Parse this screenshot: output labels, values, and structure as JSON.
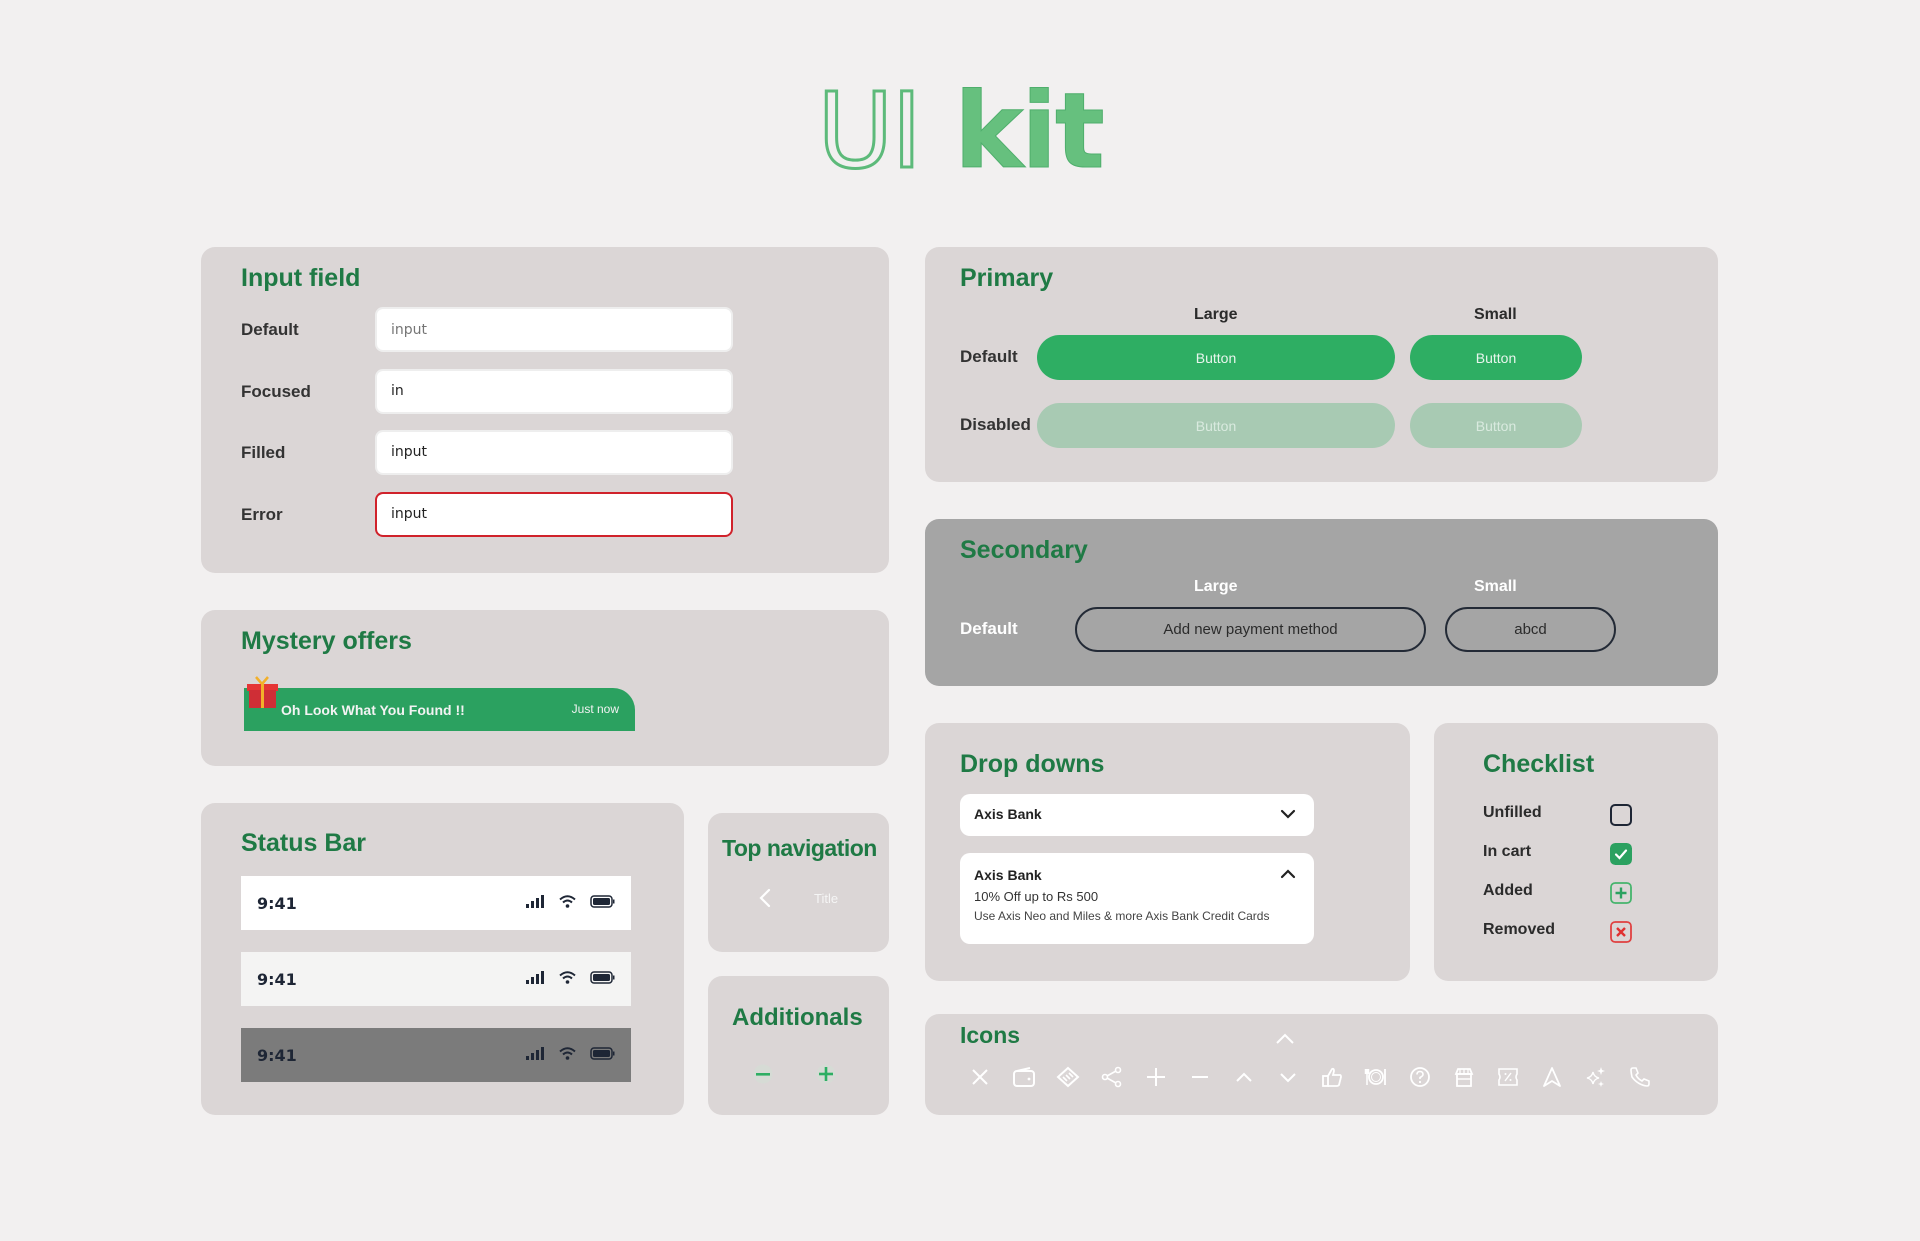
{
  "header": {
    "title_outline": "UI",
    "title_solid": "kit"
  },
  "colors": {
    "brand_green": "#2eae63",
    "title_green": "#1f7a45",
    "error_red": "#d0222b",
    "panel_bg": "#dbd6d6",
    "page_bg": "#f2f0f0"
  },
  "input_field": {
    "title": "Input field",
    "rows": [
      {
        "label": "Default",
        "value": "",
        "placeholder": "input",
        "state": "default"
      },
      {
        "label": "Focused",
        "value": "in",
        "placeholder": "",
        "state": "focused"
      },
      {
        "label": "Filled",
        "value": "input",
        "placeholder": "",
        "state": "filled"
      },
      {
        "label": "Error",
        "value": "input",
        "placeholder": "",
        "state": "error"
      }
    ]
  },
  "mystery_offers": {
    "title": "Mystery offers",
    "message": "Oh Look What You Found !!",
    "time": "Just now",
    "icon": "gift-icon"
  },
  "status_bar": {
    "title": "Status Bar",
    "bars": [
      {
        "time": "9:41",
        "variant": "white",
        "bg": "#ffffff"
      },
      {
        "time": "9:41",
        "variant": "light",
        "bg": "#f4f4f3"
      },
      {
        "time": "9:41",
        "variant": "dark",
        "bg": "#7b7b7b"
      }
    ],
    "icons": [
      "signal-icon",
      "wifi-icon",
      "battery-icon"
    ]
  },
  "top_navigation": {
    "title": "Top navigation",
    "nav_title": "Title",
    "back_icon": "chevron-left-icon"
  },
  "additionals": {
    "title": "Additionals",
    "icons": [
      "minus-icon",
      "plus-icon"
    ]
  },
  "primary": {
    "title": "Primary",
    "columns": [
      "Large",
      "Small"
    ],
    "rows": [
      {
        "label": "Default",
        "large": "Button",
        "small": "Button"
      },
      {
        "label": "Disabled",
        "large": "Button",
        "small": "Button"
      }
    ]
  },
  "secondary": {
    "title": "Secondary",
    "columns": [
      "Large",
      "Small"
    ],
    "rows": [
      {
        "label": "Default",
        "large": "Add new payment method",
        "small": "abcd"
      }
    ]
  },
  "dropdowns": {
    "title": "Drop downs",
    "collapsed": {
      "selected": "Axis Bank"
    },
    "expanded": {
      "selected": "Axis Bank",
      "offer": "10% Off up to Rs 500",
      "details": "Use Axis Neo and Miles & more Axis Bank Credit Cards"
    }
  },
  "checklist": {
    "title": "Checklist",
    "items": [
      {
        "label": "Unfilled",
        "state": "unchecked"
      },
      {
        "label": "In cart",
        "state": "checked"
      },
      {
        "label": "Added",
        "state": "added"
      },
      {
        "label": "Removed",
        "state": "removed"
      }
    ]
  },
  "icons_panel": {
    "title": "Icons",
    "icons": [
      "close-icon",
      "wallet-icon",
      "handshake-icon",
      "share-icon",
      "plus-icon",
      "minus-icon",
      "chevron-up-icon",
      "chevron-down-icon",
      "thumbs-up-icon",
      "dining-icon",
      "help-icon",
      "store-icon",
      "coupon-icon",
      "navigation-icon",
      "sparkle-icon",
      "phone-icon"
    ]
  }
}
